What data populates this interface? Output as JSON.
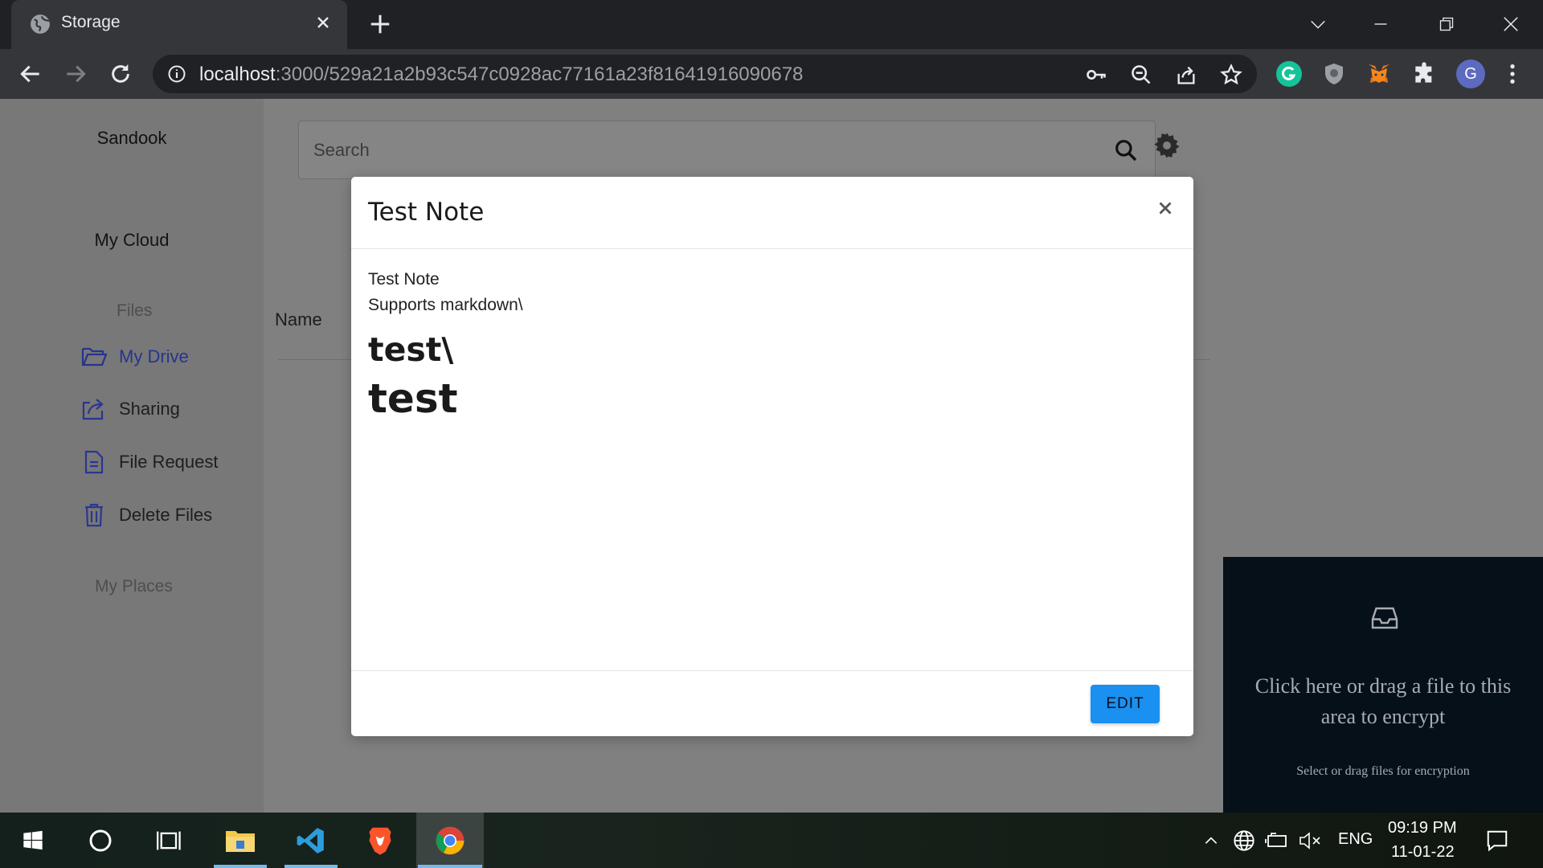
{
  "browser": {
    "tab_title": "Storage",
    "url_host": "localhost",
    "url_path": ":3000/529a21a2b93c547c0928ac77161a23f81641916090678",
    "profile_initial": "G"
  },
  "app": {
    "brand": "Sandook",
    "my_cloud": "My Cloud",
    "files_section": "Files",
    "nav_items": [
      {
        "label": "My Drive",
        "icon": "folder-open-icon",
        "active": true
      },
      {
        "label": "Sharing",
        "icon": "share-icon",
        "active": false
      },
      {
        "label": "File Request",
        "icon": "document-icon",
        "active": false
      },
      {
        "label": "Delete Files",
        "icon": "trash-icon",
        "active": false
      }
    ],
    "my_places": "My Places",
    "search_placeholder": "Search",
    "column_name": "Name",
    "drop_zone": {
      "text": "Click here or drag a file to this area to encrypt",
      "hint": "Select or drag files for encryption"
    }
  },
  "modal": {
    "title": "Test Note",
    "body_lines": [
      "Test Note",
      "Supports markdown\\"
    ],
    "heading_1": "test\\",
    "heading_2": "test",
    "edit_label": "EDIT"
  },
  "taskbar": {
    "language": "ENG",
    "time": "09:19 PM",
    "date": "11-01-22"
  },
  "colors": {
    "accent_blue": "#1a90f0",
    "active_nav": "#26348f",
    "overlay_gray": "#808080"
  }
}
